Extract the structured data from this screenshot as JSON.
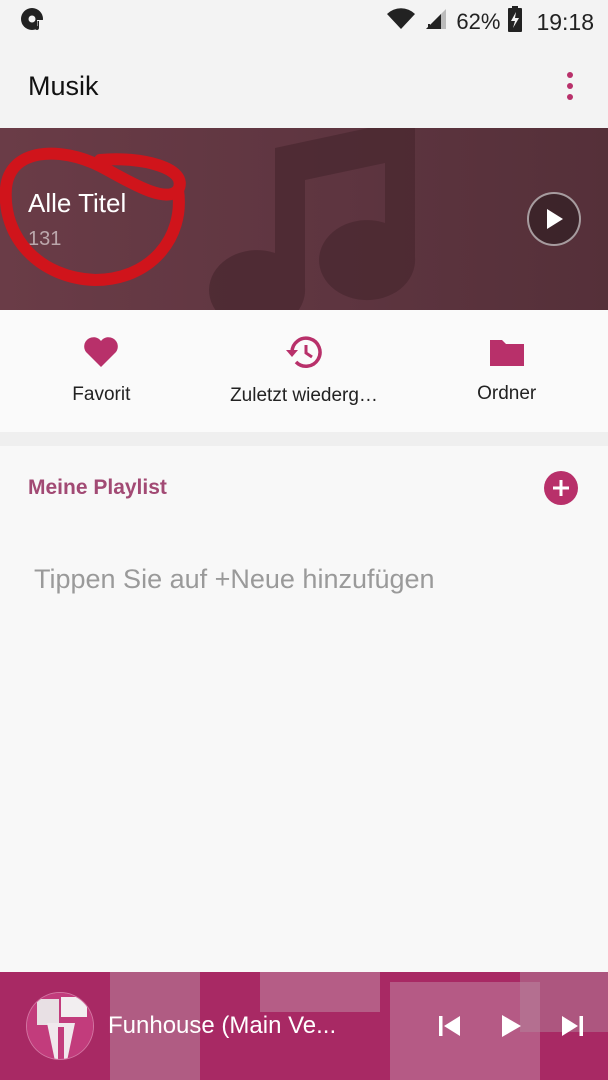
{
  "status_bar": {
    "battery": "62%",
    "time": "19:18",
    "icons": [
      "music-notification-icon",
      "wifi-icon",
      "signal-icon",
      "battery-icon"
    ]
  },
  "app_bar": {
    "title": "Musik",
    "menu_icon": "more-vert-icon"
  },
  "hero": {
    "title": "Alle Titel",
    "count": "131"
  },
  "quick_actions": [
    {
      "label": "Favorit",
      "icon": "heart-icon"
    },
    {
      "label": "Zuletzt wiederg…",
      "icon": "history-icon"
    },
    {
      "label": "Ordner",
      "icon": "folder-icon"
    }
  ],
  "playlist": {
    "title": "Meine Playlist",
    "empty_hint": "Tippen Sie auf +Neue hinzufügen"
  },
  "player": {
    "track": "Funhouse (Main Ve..."
  },
  "colors": {
    "accent": "#b8306a",
    "playlist_title": "#a24a74",
    "hero_bg": "#5e3540",
    "annotation_red": "#d0141b"
  }
}
